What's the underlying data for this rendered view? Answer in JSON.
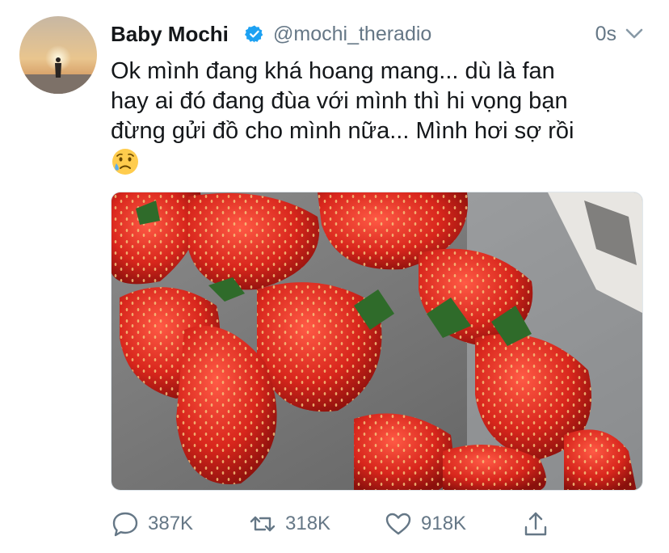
{
  "tweet": {
    "author_name": "Baby Mochi",
    "handle": "@mochi_theradio",
    "time": "0s",
    "text_lines": [
      "Ok mình đang khá hoang mang... dù là fan",
      "hay ai đó đang đùa với mình thì hi vọng bạn",
      "đừng gửi đồ cho mình nữa... Mình hơi sợ rồi"
    ],
    "emoji": "sad-sweat-face",
    "photo_subject": "strawberries-photo"
  },
  "actions": {
    "replies": "387K",
    "retweets": "318K",
    "likes": "918K"
  },
  "colors": {
    "text": "#14171a",
    "secondary": "#657786",
    "verified": "#1da1f2"
  },
  "icons": [
    "verified-badge-icon",
    "chevron-down-icon",
    "reply-icon",
    "retweet-icon",
    "like-icon",
    "share-icon"
  ]
}
